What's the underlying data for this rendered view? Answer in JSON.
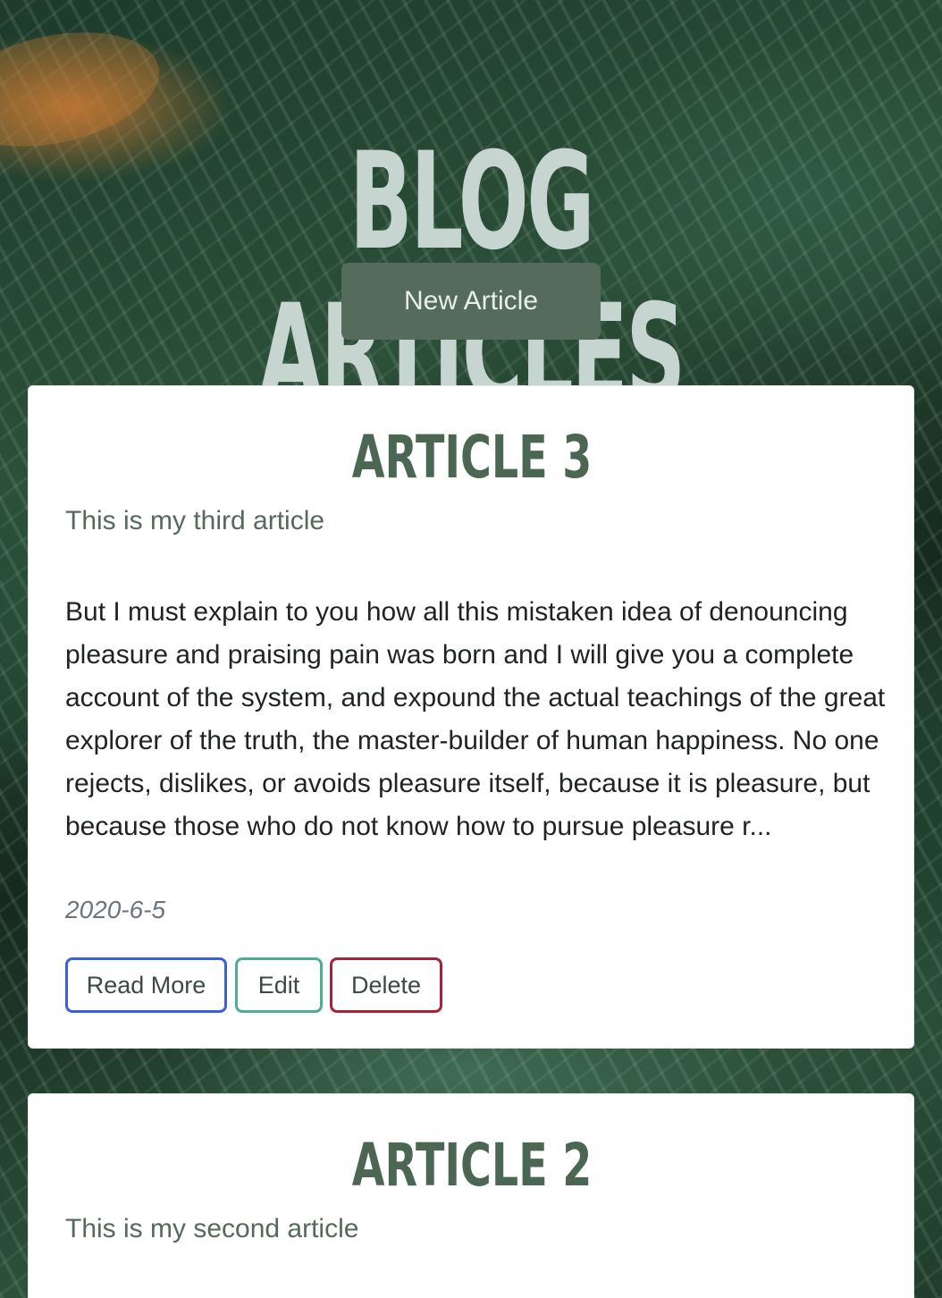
{
  "header": {
    "title": "Blog Articles",
    "new_article_label": "New Article"
  },
  "articles": [
    {
      "title": "Article 3",
      "description": "This is my third article",
      "body": "But I must explain to you how all this mistaken idea of denouncing pleasure and praising pain was born and I will give you a complete account of the system, and expound the actual teachings of the great explorer of the truth, the master-builder of human happiness. No one rejects, dislikes, or avoids pleasure itself, because it is pleasure, but because those who do not know how to pursue pleasure r...",
      "date": "2020-6-5",
      "read_more_label": "Read More",
      "edit_label": "Edit",
      "delete_label": "Delete"
    },
    {
      "title": "Article 2",
      "description": "This is my second article"
    }
  ],
  "colors": {
    "primary_button": "#556b5c",
    "title_text": "#c7d5d0",
    "card_title": "#4b6653",
    "read_more_border": "#3a5fe0",
    "edit_border": "#4fae8c",
    "delete_border": "#a3243a"
  }
}
